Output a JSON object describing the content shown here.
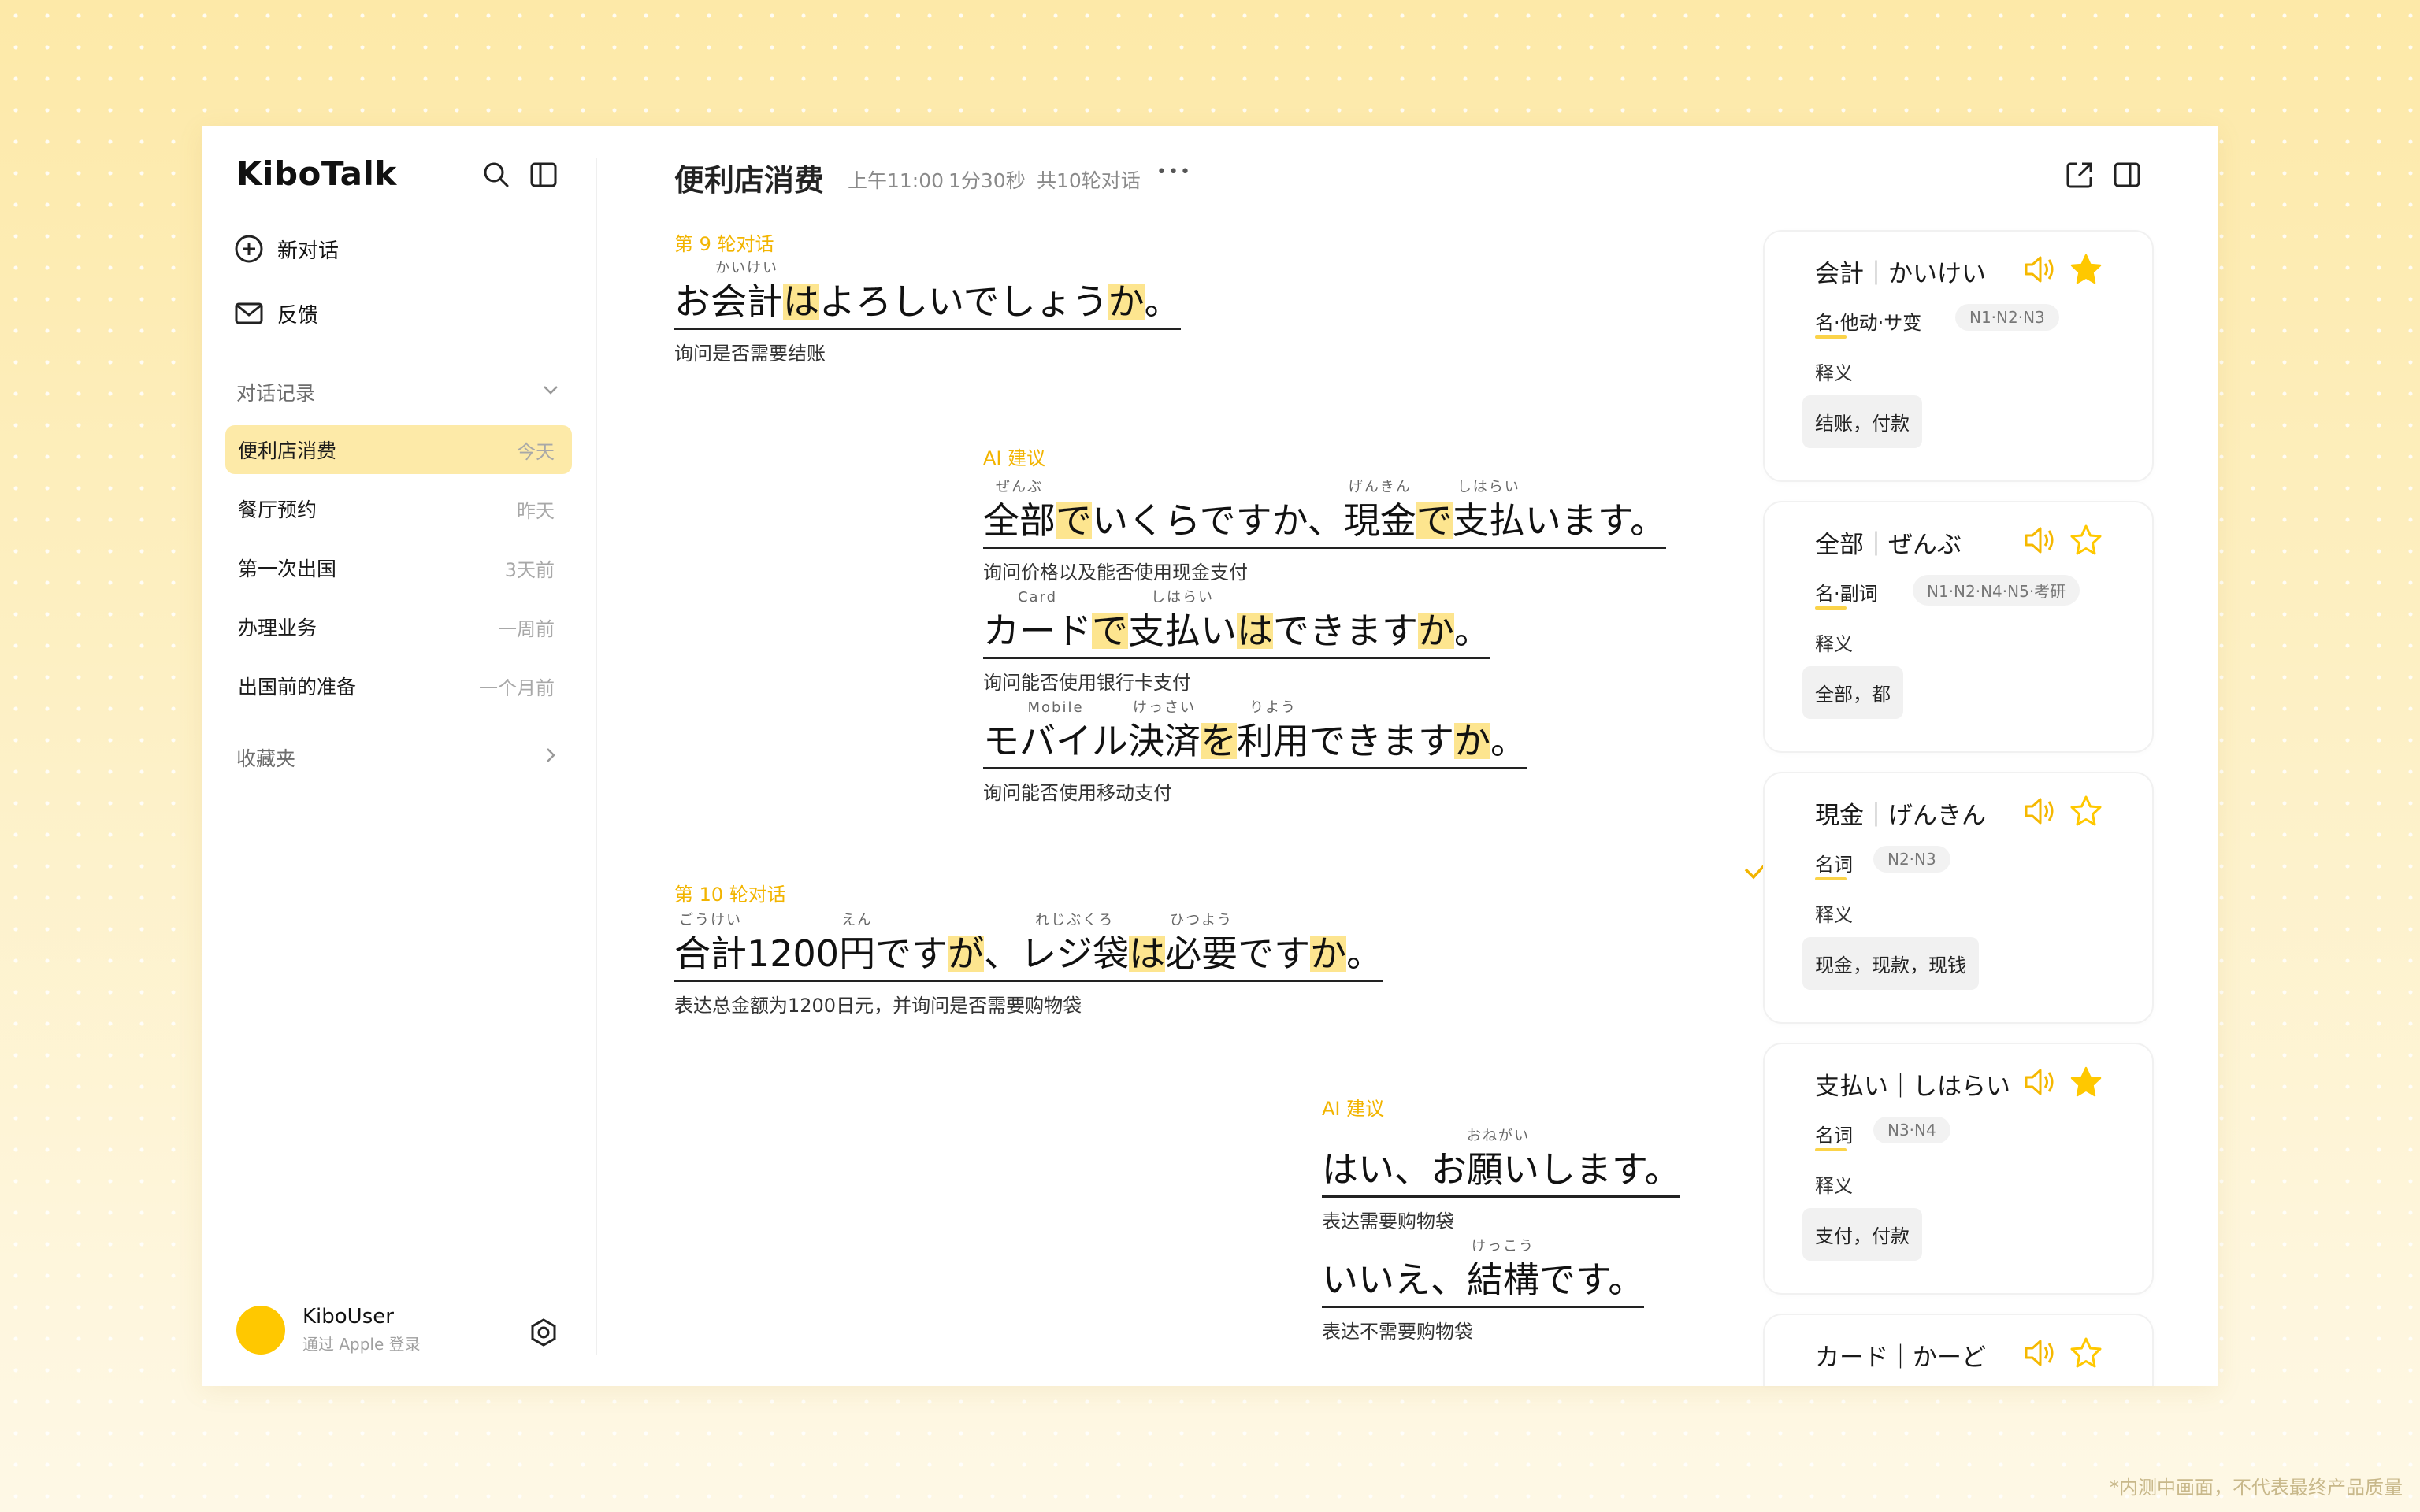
{
  "app": {
    "name": "KiboTalk"
  },
  "sidebar": {
    "new_chat": "新对话",
    "feedback": "反馈",
    "history_title": "对话记录",
    "history": [
      {
        "title": "便利店消费",
        "time": "今天"
      },
      {
        "title": "餐厅预约",
        "time": "昨天"
      },
      {
        "title": "第一次出国",
        "time": "3天前"
      },
      {
        "title": "办理业务",
        "time": "一周前"
      },
      {
        "title": "出国前的准备",
        "time": "一个月前"
      }
    ],
    "favorites": "收藏夹",
    "user": {
      "name": "KiboUser",
      "sub": "通过 Apple 登录"
    }
  },
  "header": {
    "title": "便利店消费",
    "time": "上午11:00",
    "duration": "1分30秒",
    "rounds": "共10轮对话",
    "more": "•••"
  },
  "conversation": {
    "round9": {
      "label": "第 9 轮对话",
      "sentence": "お会計はよろしいでしょうか。",
      "translation": "询问是否需要结账"
    },
    "ai1": {
      "label": "AI 建议",
      "s1": "全部でいくらですか、現金で支払います。",
      "t1": "询问价格以及能否使用现金支付",
      "s2": "カードで支払いはできますか。",
      "t2": "询问能否使用银行卡支付",
      "s3": "モバイル決済を利用できますか。",
      "t3": "询问能否使用移动支付"
    },
    "round10": {
      "label": "第 10 轮对话",
      "sentence": "合計1200円ですが、レジ袋は必要ですか。",
      "translation": "表达总金额为1200日元，并询问是否需要购物袋"
    },
    "ai2": {
      "label": "AI 建议",
      "s1": "はい、お願いします。",
      "t1": "表达需要购物袋",
      "s2": "いいえ、結構です。",
      "t2": "表达不需要购物袋"
    },
    "ruby": {
      "kaikei": "かいけい",
      "zenbu": "ぜんぶ",
      "genkin": "げんきん",
      "shiharai": "しはらい",
      "card": "Card",
      "mobile": "Mobile",
      "kessai": "けっさい",
      "riyou": "りよう",
      "goukei": "ごうけい",
      "en": "えん",
      "rejibukuro": "れじぶくろ",
      "hitsuyou": "ひつよう",
      "onegai": "おねがい",
      "kekkou": "けっこう"
    }
  },
  "cards": [
    {
      "word": "会計｜かいけい",
      "pos": "名·他动·サ变",
      "level": "N1·N2·N3",
      "mean_label": "释义",
      "meaning": "结账，付款",
      "starred": true
    },
    {
      "word": "全部｜ぜんぶ",
      "pos": "名·副词",
      "level": "N1·N2·N4·N5·考研",
      "mean_label": "释义",
      "meaning": "全部，都",
      "starred": false
    },
    {
      "word": "現金｜げんきん",
      "pos": "名词",
      "level": "N2·N3",
      "mean_label": "释义",
      "meaning": "现金，现款，现钱",
      "starred": false
    },
    {
      "word": "支払い｜しはらい",
      "pos": "名词",
      "level": "N3·N4",
      "mean_label": "释义",
      "meaning": "支付，付款",
      "starred": true
    },
    {
      "word": "カード｜かーど",
      "starred": false
    }
  ],
  "footer_note": "*内测中画面，不代表最终产品质量",
  "colors": {
    "accent": "#FFC800",
    "highlight": "#FDE58F",
    "label": "#F2B400"
  }
}
